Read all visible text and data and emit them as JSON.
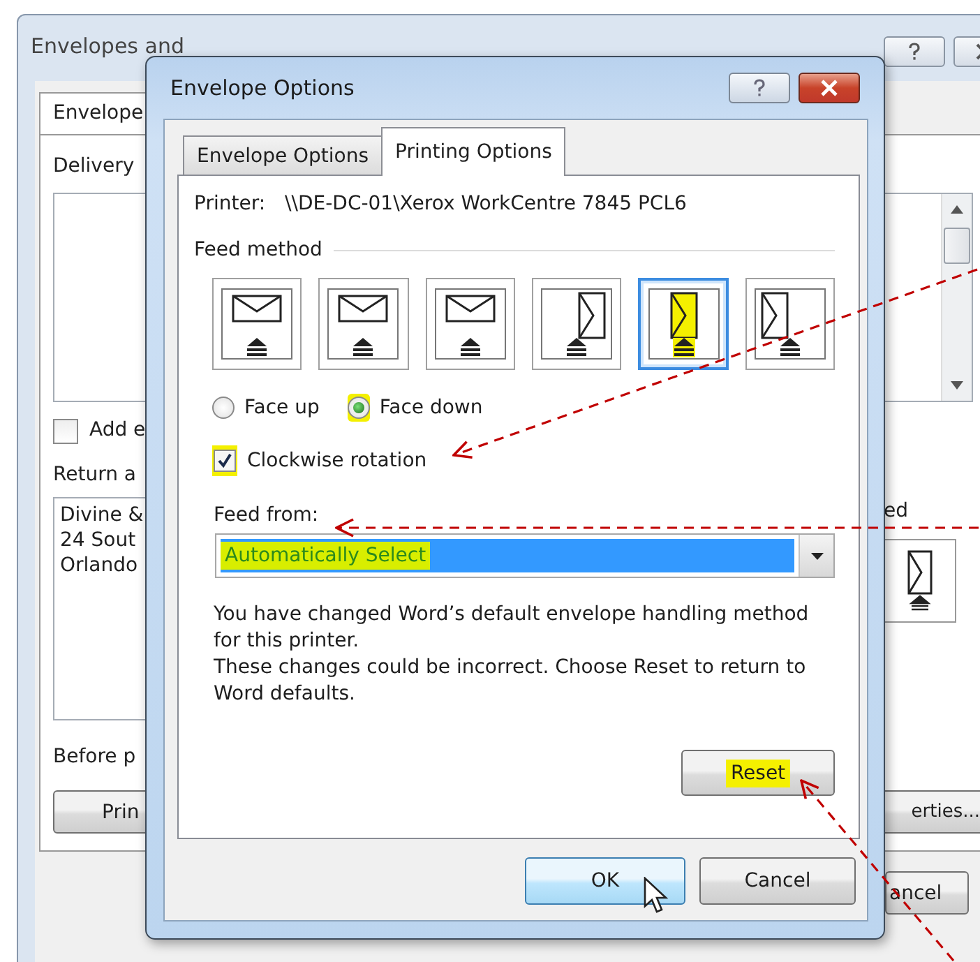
{
  "background_window": {
    "title": "Envelopes and",
    "tab": "Envelope",
    "delivery_label": "Delivery",
    "add_checkbox": {
      "label": "Add e",
      "checked": false
    },
    "return_label": "Return a",
    "return_lines": [
      "Divine &",
      "24 Sout",
      "Orlando"
    ],
    "preview_label": "ed",
    "before_label": "Before p",
    "print_button": "Prin",
    "properties_button": "erties...",
    "cancel_button": "ancel"
  },
  "dialog": {
    "title": "Envelope Options",
    "tabs": [
      {
        "label": "Envelope Options",
        "selected": false
      },
      {
        "label": "Printing Options",
        "selected": true
      }
    ],
    "printer_label": "Printer:",
    "printer": "\\\\DE-DC-01\\Xerox WorkCentre 7845 PCL6",
    "feed_method_label": "Feed method",
    "feed_methods": [
      {
        "kind": "landscape",
        "selected": false,
        "highlighted": false
      },
      {
        "kind": "landscape",
        "selected": false,
        "highlighted": false
      },
      {
        "kind": "landscape",
        "selected": false,
        "highlighted": false
      },
      {
        "kind": "portrait-right",
        "selected": false,
        "highlighted": false
      },
      {
        "kind": "portrait-center",
        "selected": true,
        "highlighted": true
      },
      {
        "kind": "portrait-left",
        "selected": false,
        "highlighted": false
      }
    ],
    "face_options": [
      {
        "label": "Face up",
        "selected": false,
        "highlighted": false
      },
      {
        "label": "Face down",
        "selected": true,
        "highlighted": true
      }
    ],
    "clockwise": {
      "label": "Clockwise rotation",
      "checked": true,
      "highlighted": true
    },
    "feed_from_label": "Feed from:",
    "feed_from": {
      "value": "Automatically Select",
      "highlighted": true
    },
    "message": [
      "You have changed Word’s default envelope handling method for this printer.",
      "These changes could be incorrect. Choose Reset to return to Word defaults."
    ],
    "reset_button": {
      "label": "Reset",
      "highlighted": true
    },
    "ok_button": "OK",
    "cancel_button": "Cancel"
  }
}
